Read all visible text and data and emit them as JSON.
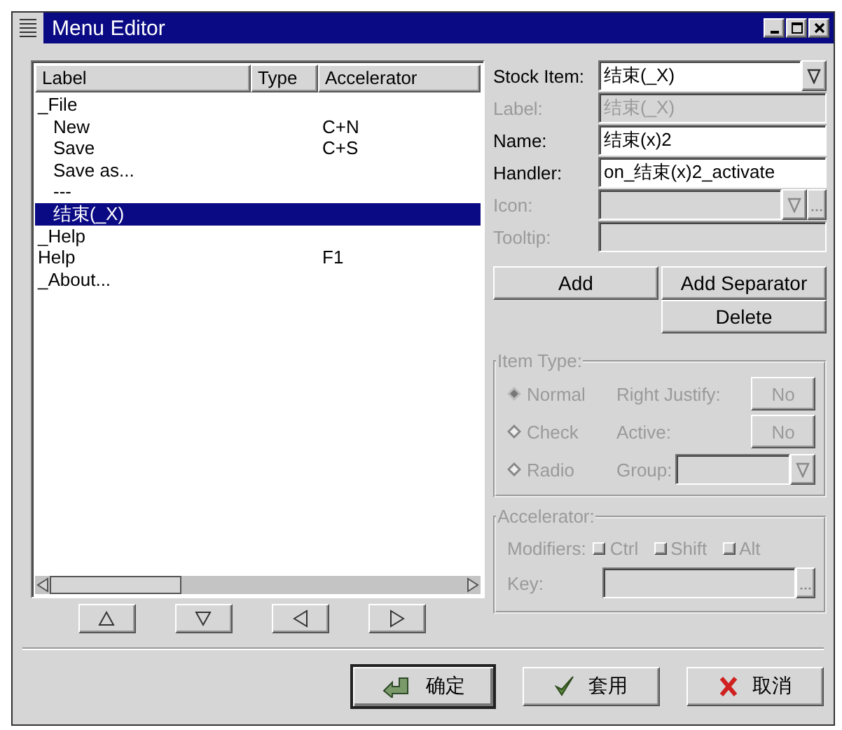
{
  "window": {
    "title": "Menu Editor"
  },
  "list": {
    "columns": [
      "Label",
      "Type",
      "Accelerator"
    ],
    "rows": [
      {
        "label": "_File",
        "selected": false,
        "children": [
          {
            "label": "New",
            "accelerator": "C+N",
            "selected": false
          },
          {
            "label": "Save",
            "accelerator": "C+S",
            "selected": false
          },
          {
            "label": "Save as...",
            "selected": false
          },
          {
            "label": "---",
            "selected": false
          },
          {
            "label": "结束(_X)",
            "selected": true
          }
        ]
      },
      {
        "label": "_Help",
        "selected": false
      },
      {
        "label": "Help",
        "accelerator": "F1",
        "selected": false
      },
      {
        "label": "_About...",
        "selected": false
      }
    ]
  },
  "properties": {
    "fields": [
      {
        "label": "Stock Item:",
        "value": "结束(_X)",
        "kind": "combo",
        "disabled": false
      },
      {
        "label": "Label:",
        "value": "结束(_X)",
        "kind": "entry",
        "disabled": true
      },
      {
        "label": "Name:",
        "value": "结束(x)2",
        "kind": "entry",
        "disabled": false
      },
      {
        "label": "Handler:",
        "value": "on_结束(x)2_activate",
        "kind": "entry",
        "disabled": false
      },
      {
        "label": "Icon:",
        "kind": "chooser",
        "disabled": true
      },
      {
        "label": "Tooltip:",
        "kind": "entry",
        "disabled": true
      }
    ],
    "buttons": [
      "Add",
      "Add Separator",
      "Delete"
    ]
  },
  "item_type": {
    "title": "Item Type:",
    "disabled": true,
    "options": [
      {
        "label": "Normal",
        "selected": true
      },
      {
        "label": "Check",
        "selected": false
      },
      {
        "label": "Radio",
        "selected": false
      }
    ],
    "settings": [
      {
        "label": "Right Justify:",
        "kind": "toggle",
        "value": "No"
      },
      {
        "label": "Active:",
        "kind": "toggle",
        "value": "No"
      },
      {
        "label": "Group:",
        "kind": "combo"
      }
    ]
  },
  "accelerator": {
    "title": "Accelerator:",
    "disabled": true,
    "modifiers_label": "Modifiers:",
    "modifiers": [
      {
        "label": "Ctrl",
        "checked": false
      },
      {
        "label": "Shift",
        "checked": false
      },
      {
        "label": "Alt",
        "checked": false
      }
    ],
    "key_label": "Key:"
  },
  "dialog_buttons": [
    {
      "label": "确定",
      "kind": "ok",
      "default": true
    },
    {
      "label": "套用",
      "kind": "apply",
      "default": false
    },
    {
      "label": "取消",
      "kind": "cancel",
      "default": false
    }
  ]
}
